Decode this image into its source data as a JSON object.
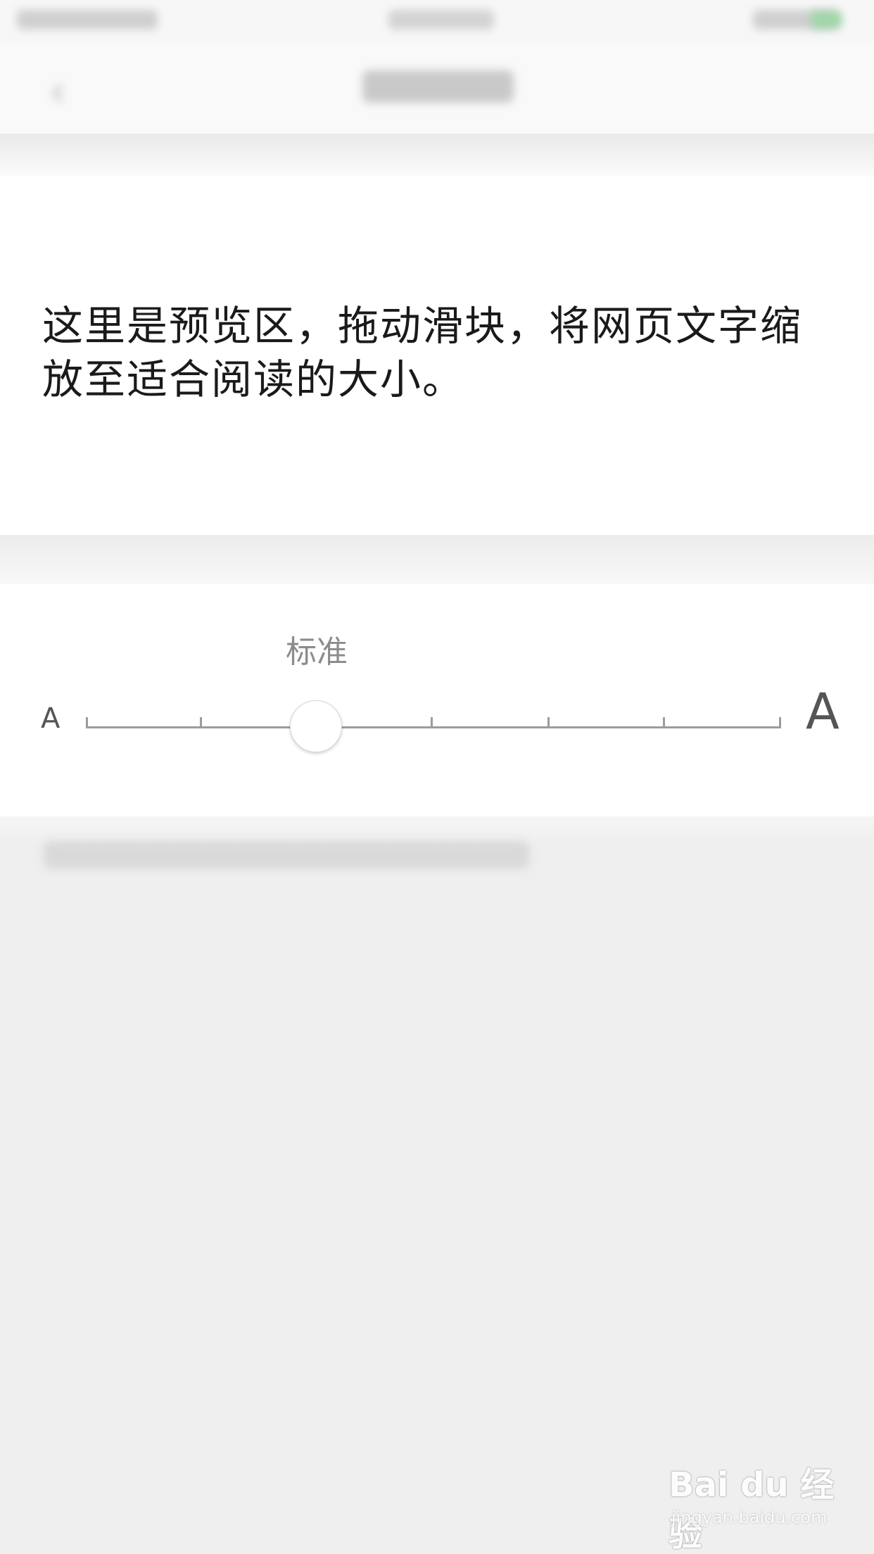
{
  "preview": {
    "text": "这里是预览区，拖动滑块，将网页文字缩放至适合阅读的大小。"
  },
  "slider": {
    "current_label": "标准",
    "small_label": "A",
    "large_label": "A",
    "level_count": 7,
    "selected_index": 2
  },
  "watermark": {
    "logo": "Bai du 经验",
    "url": "jingyan.baidu.com"
  }
}
